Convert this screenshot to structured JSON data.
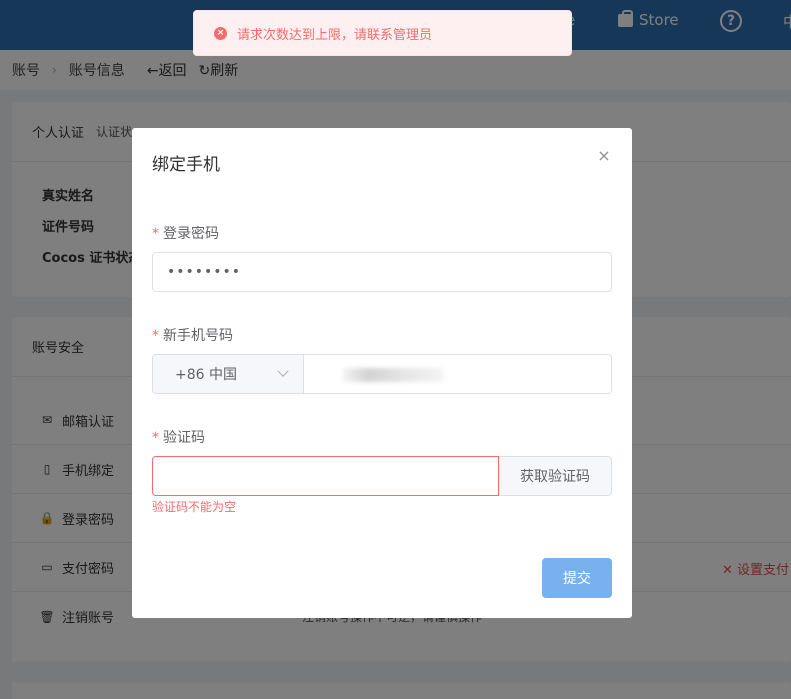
{
  "topbar": {
    "partial_left": "e",
    "store": "Store",
    "help": "?",
    "lang_partial": "中"
  },
  "breadcrumb": {
    "root": "账号",
    "sep": "›",
    "current": "账号信息",
    "back": "←返回",
    "refresh": "↻刷新"
  },
  "identity_card": {
    "title": "个人认证",
    "subtitle": "认证状",
    "fields": [
      "真实姓名",
      "证件号码",
      "Cocos 证书状态"
    ]
  },
  "security_card": {
    "title": "账号安全",
    "rows": [
      {
        "icon": "mail-icon",
        "glyph": "✉",
        "label": "邮箱认证"
      },
      {
        "icon": "phone-icon",
        "glyph": "▯",
        "label": "手机绑定"
      },
      {
        "icon": "lock-icon",
        "glyph": "🔒",
        "label": "登录密码"
      },
      {
        "icon": "wallet-icon",
        "glyph": "▭",
        "label": "支付密码"
      },
      {
        "icon": "trash-icon",
        "glyph": "🗑",
        "label": "注销账号"
      }
    ],
    "set_payment_link": "✕ 设置支付",
    "cancel_note": "注销账号操作不可逆，请谨慎操作"
  },
  "dialog": {
    "title": "绑定手机",
    "close": "×",
    "password_label": "登录密码",
    "password_value": "••••••••",
    "phone_label": "新手机号码",
    "country": "+86 中国",
    "code_label": "验证码",
    "code_placeholder": "",
    "get_code_button": "获取验证码",
    "code_error": "验证码不能为空",
    "submit": "提交",
    "required_mark": "*"
  },
  "toast": {
    "icon": "×",
    "message": "请求次数达到上限，请联系管理员"
  },
  "colors": {
    "topbar": "#2f6fb3",
    "error": "#f56c6c",
    "primary_disabled": "#79b1ef"
  }
}
